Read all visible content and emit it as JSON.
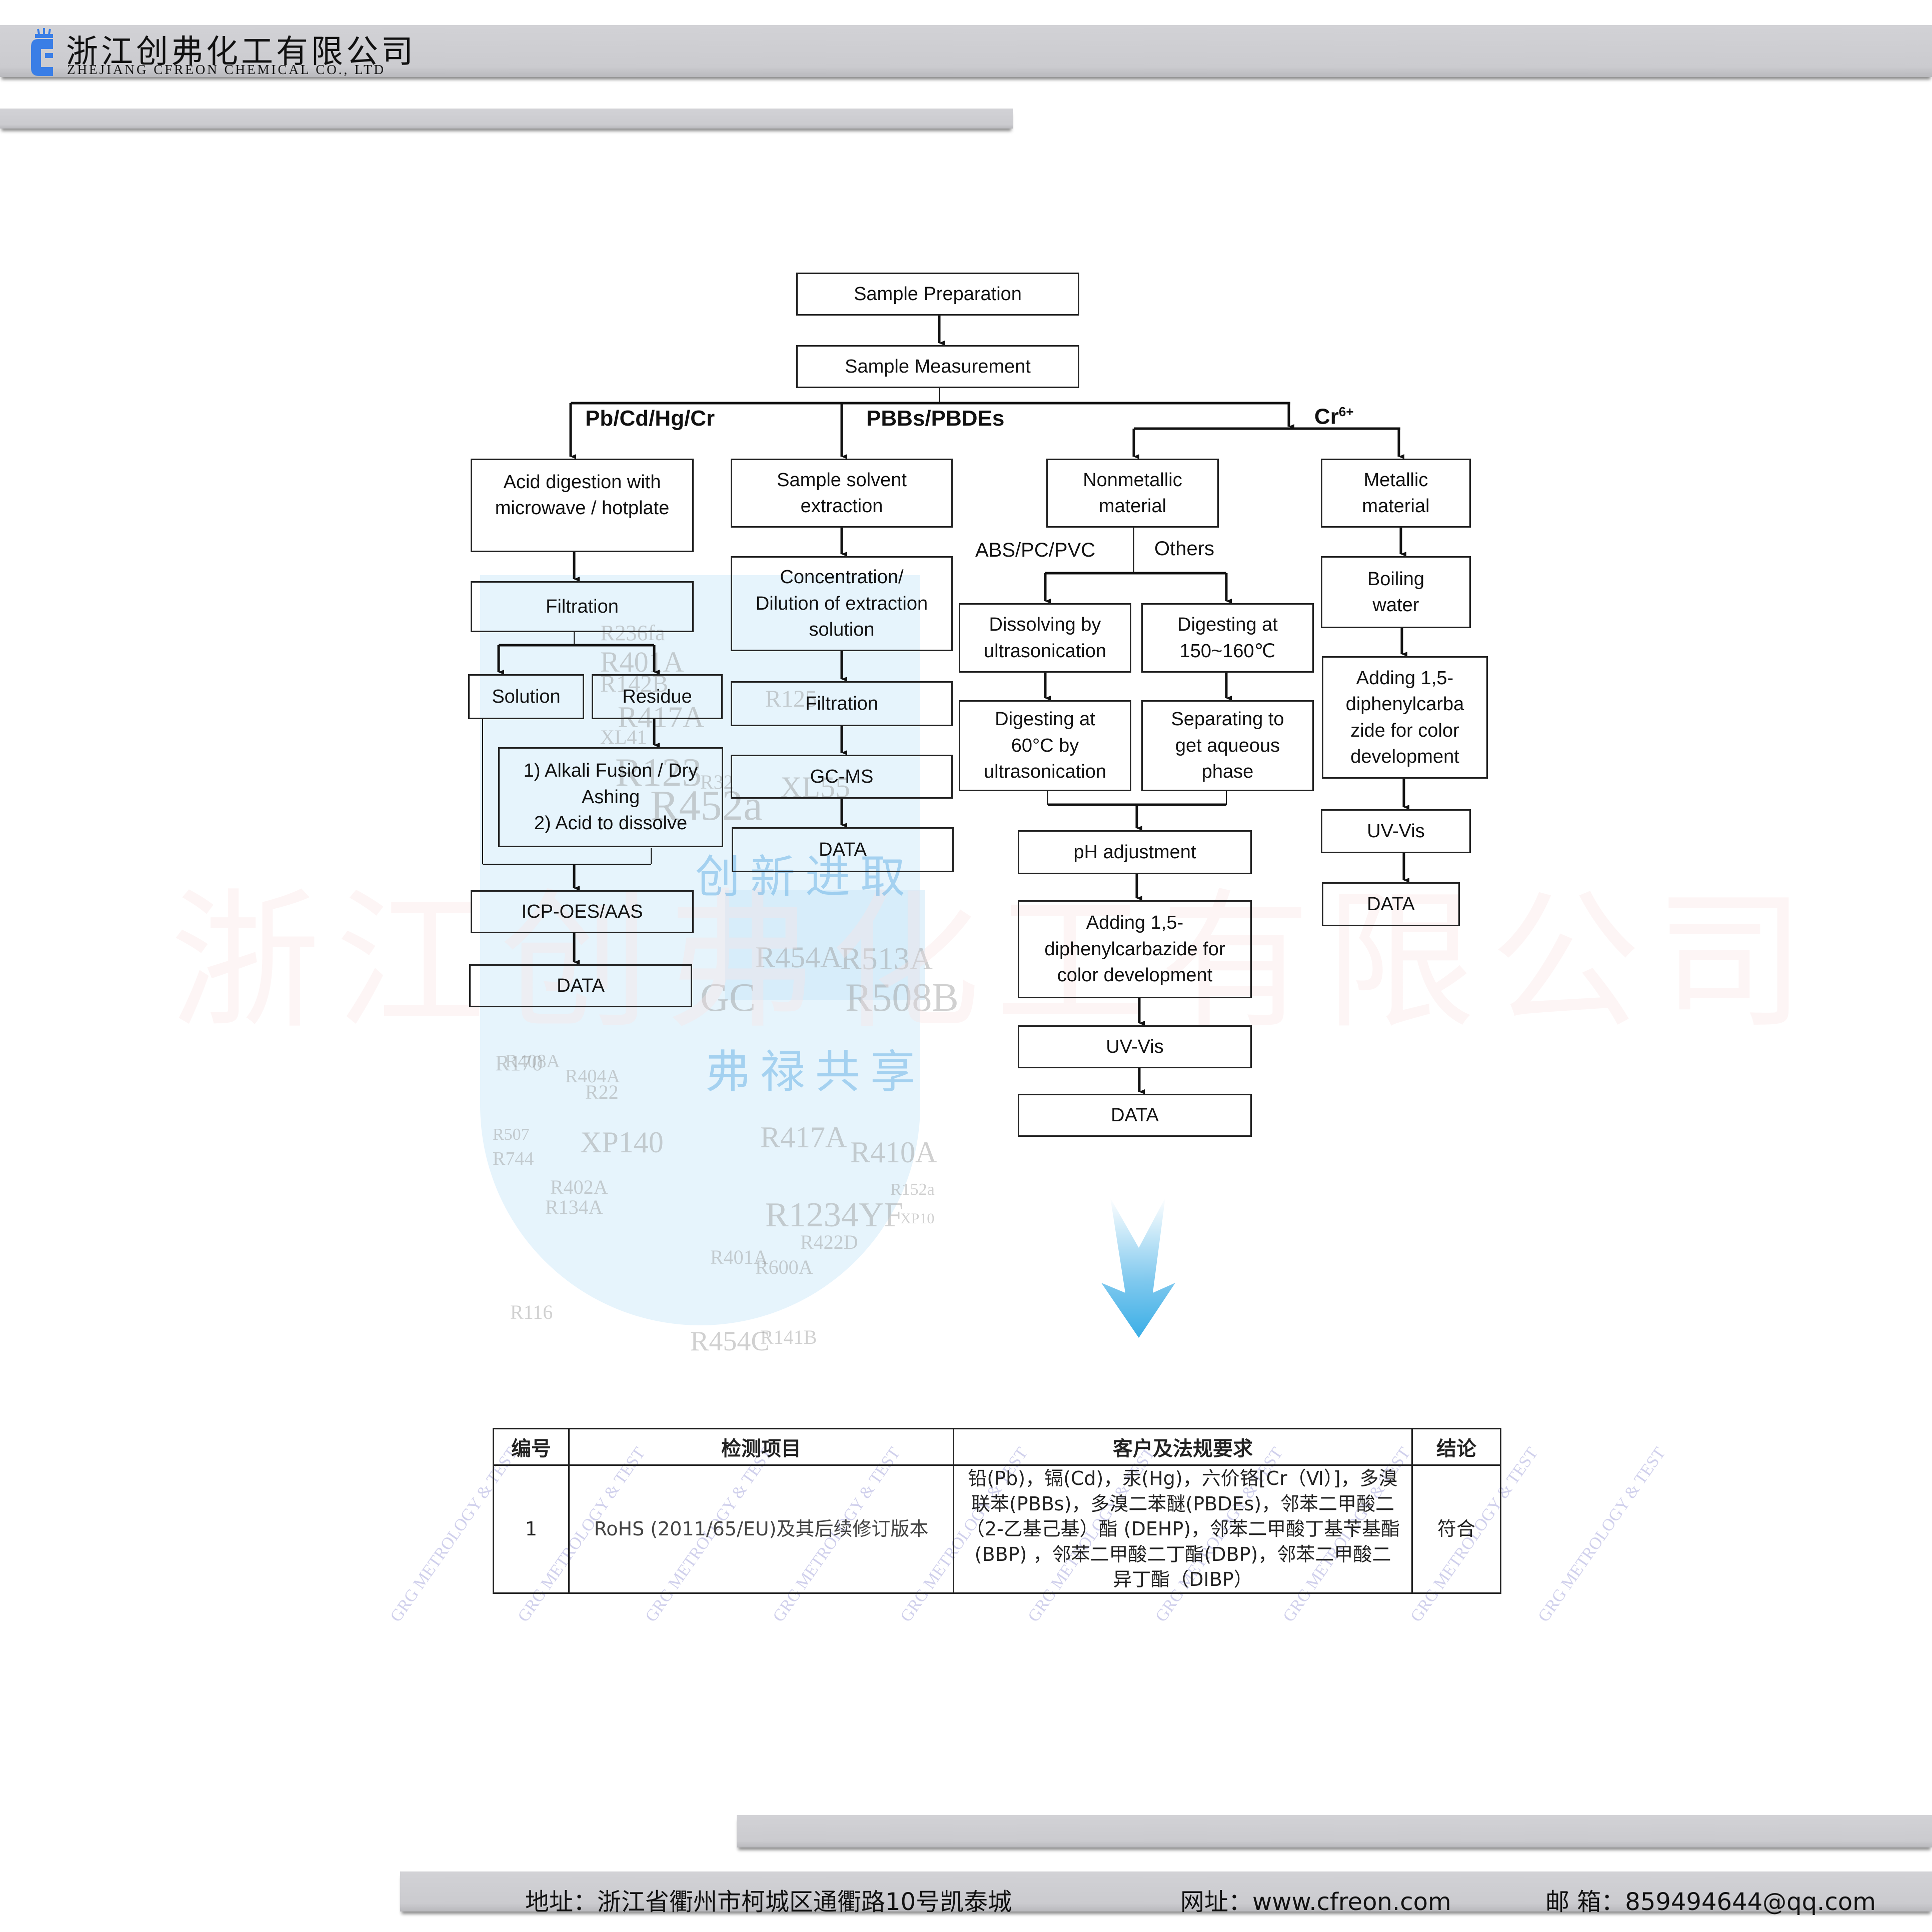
{
  "header": {
    "company_cn": "浙江创弗化工有限公司",
    "company_en": "ZHEJIANG CFREON CHEMICAL  CO., LTD",
    "logo_icon": "cylinder-c-logo-icon",
    "brand_color": "#3a7ee6"
  },
  "flowchart": {
    "top": [
      "Sample Preparation",
      "Sample Measurement"
    ],
    "branch_labels": {
      "heavy_metals": "Pb/Cd/Hg/Cr",
      "flame_retardants": "PBBs/PBDEs",
      "chromium": "Cr",
      "chromium_sup": "6+"
    },
    "heavy_metals": {
      "digestion": "Acid digestion with\nmicrowave / hotplate",
      "filtration": "Filtration",
      "solution": "Solution",
      "residue": "Residue",
      "residue_treatment": "1) Alkali Fusion / Dry\nAshing\n2) Acid to dissolve",
      "instrument": "ICP-OES/AAS",
      "data": "DATA"
    },
    "flame_retardants": {
      "extraction": "Sample solvent\nextraction",
      "concentration": "Concentration/\nDilution of extraction\nsolution",
      "filtration": "Filtration",
      "instrument": "GC-MS",
      "data": "DATA"
    },
    "chromium": {
      "nonmetallic": "Nonmetallic\nmaterial",
      "metallic": "Metallic\nmaterial",
      "label_abs": "ABS/PC/PVC",
      "label_others": "Others",
      "dissolving": "Dissolving by\nultrasonication",
      "digesting_high": "Digesting at\n150~160℃",
      "digesting_60": "Digesting at\n60°C by\nultrasonication",
      "separating": "Separating to\nget aqueous\nphase",
      "ph": "pH adjustment",
      "adding_nm": "Adding 1,5-\ndiphenylcarbazide for\ncolor development",
      "uvvis_nm": "UV-Vis",
      "data_nm": "DATA",
      "boiling": "Boiling\nwater",
      "adding_m": "Adding 1,5-\ndiphenylcarba\nzide for color\ndevelopment",
      "uvvis_m": "UV-Vis",
      "data_m": "DATA"
    }
  },
  "watermark": {
    "company": "浙江创弗化工有限公司",
    "slogan_top": "创新进取",
    "slogan_bottom": "弗禄共享",
    "codes": [
      "R236fa",
      "R401A",
      "R142B",
      "R417A",
      "R123",
      "R452a",
      "R125",
      "XL55",
      "GC",
      "R454A",
      "R513A",
      "R508B",
      "R170",
      "R404A",
      "R507",
      "XP140",
      "R744",
      "R22",
      "R402A",
      "R410A",
      "R401A",
      "R454C",
      "R141B",
      "R417A",
      "R1234YF",
      "R422D",
      "R116",
      "R134A",
      "R408A",
      "R600A",
      "XL41",
      "R32",
      "XP10",
      "R152a"
    ],
    "stamp_text": "GRG METROLOGY & TEST"
  },
  "divider_arrow_icon": "down-arrow-icon",
  "table": {
    "headers": [
      "编号",
      "检测项目",
      "客户及法规要求",
      "结论"
    ],
    "rows": [
      {
        "no": "1",
        "item": "RoHS (2011/65/EU)及其后续修订版本",
        "requirement": "铅(Pb)，镉(Cd)，汞(Hg)，六价铬[Cr（Ⅵ）]，多溴联苯(PBBs)，多溴二苯醚(PBDEs)，邻苯二甲酸二（2-乙基己基）酯 (DEHP)，邻苯二甲酸丁基苄基酯(BBP) ，邻苯二甲酸二丁酯(DBP)，邻苯二甲酸二异丁酯（DIBP）",
        "conclusion": "符合"
      }
    ]
  },
  "footer": {
    "address_label": "地址：",
    "address": "浙江省衢州市柯城区通衢路10号凯泰城",
    "website_label": "网址：",
    "website": "www.cfreon.com",
    "email_label": "邮  箱：",
    "email": "859494644@qq.com"
  }
}
